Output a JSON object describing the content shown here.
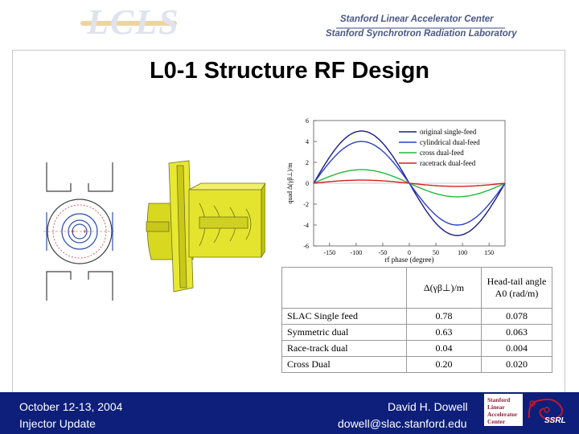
{
  "header": {
    "logo": "LCLS",
    "org_line1": "Stanford Linear Accelerator Center",
    "org_line2": "Stanford Synchrotron Radiation Laboratory"
  },
  "slide": {
    "title": "L0-1 Structure RF Design"
  },
  "chart_data": {
    "type": "line",
    "xlabel": "rf phase (degree)",
    "ylabel": "quad Δ(γβ⊥)/m",
    "xlim": [
      -180,
      180
    ],
    "ylim": [
      -6,
      6
    ],
    "xticks": [
      "-150",
      "-100",
      "-50",
      "0",
      "50",
      "100",
      "150"
    ],
    "yticks": [
      "6",
      "4",
      "2",
      "0",
      "-2",
      "-4",
      "-6"
    ],
    "legend_position": "top-right",
    "series": [
      {
        "name": "original single-feed",
        "color": "#1a1a8c",
        "amplitude": 5.0,
        "x": [
          -180,
          -150,
          -120,
          -90,
          -60,
          -30,
          0,
          30,
          60,
          90,
          120,
          150,
          180
        ],
        "values": [
          0.0,
          2.5,
          4.3,
          5.0,
          4.3,
          2.5,
          0.0,
          -2.5,
          -4.3,
          -5.0,
          -4.3,
          -2.5,
          0.0
        ]
      },
      {
        "name": "cylindrical dual-feed",
        "color": "#2b3fc8",
        "amplitude": 4.0,
        "x": [
          -180,
          -150,
          -120,
          -90,
          -60,
          -30,
          0,
          30,
          60,
          90,
          120,
          150,
          180
        ],
        "values": [
          0.0,
          2.0,
          3.5,
          4.0,
          3.5,
          2.0,
          0.0,
          -2.0,
          -3.5,
          -4.0,
          -3.5,
          -2.0,
          0.0
        ]
      },
      {
        "name": "cross dual-feed",
        "color": "#22b83a",
        "amplitude": 1.3,
        "x": [
          -180,
          -150,
          -120,
          -90,
          -60,
          -30,
          0,
          30,
          60,
          90,
          120,
          150,
          180
        ],
        "values": [
          0.0,
          0.65,
          1.13,
          1.3,
          1.13,
          0.65,
          0.0,
          -0.65,
          -1.13,
          -1.3,
          -1.13,
          -0.65,
          0.0
        ]
      },
      {
        "name": "racetrack dual-feed",
        "color": "#d42020",
        "amplitude": 0.3,
        "x": [
          -180,
          -150,
          -120,
          -90,
          -60,
          -30,
          0,
          30,
          60,
          90,
          120,
          150,
          180
        ],
        "values": [
          0.0,
          0.15,
          0.26,
          0.3,
          0.26,
          0.15,
          0.0,
          -0.15,
          -0.26,
          -0.3,
          -0.26,
          -0.15,
          0.0
        ]
      }
    ]
  },
  "table": {
    "col2_header": "Δ(γβ⊥)/m",
    "col3_header_line1": "Head-tail angle",
    "col3_header_line2": "A0 (rad/m)",
    "rows": [
      {
        "label": "SLAC Single feed",
        "value": "0.78",
        "angle": "0.078"
      },
      {
        "label": "Symmetric dual",
        "value": "0.63",
        "angle": "0.063"
      },
      {
        "label": "Race-track dual",
        "value": "0.04",
        "angle": "0.004"
      },
      {
        "label": "Cross Dual",
        "value": "0.20",
        "angle": "0.020"
      }
    ]
  },
  "footer": {
    "date": "October 12-13, 2004",
    "event": "Injector Update",
    "author": "David H. Dowell",
    "email": "dowell@slac.stanford.edu",
    "slac_logo_lines": [
      "Stanford",
      "Linear",
      "Accelerator",
      "Center"
    ],
    "ssrl_logo": "SSRL"
  },
  "colors": {
    "footer_bg": "#0d1f7a",
    "model_yellow": "#e8e832",
    "org_text": "#4a5788"
  }
}
